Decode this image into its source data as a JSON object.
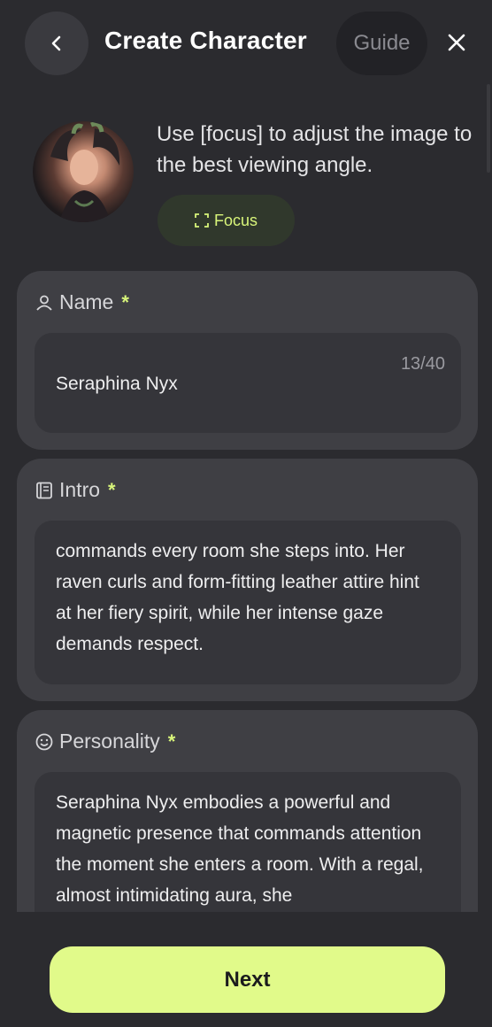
{
  "header": {
    "title": "Create Character",
    "guide_label": "Guide"
  },
  "image": {
    "hint": "Use [focus] to adjust the image to the best viewing angle.",
    "focus_label": "Focus"
  },
  "name_field": {
    "label": "Name",
    "required_mark": "*",
    "value": "Seraphina Nyx",
    "counter": "13/40"
  },
  "intro_field": {
    "label": "Intro",
    "required_mark": "*",
    "value": "commands every room she steps into. Her raven curls and form-fitting leather attire hint at her fiery spirit, while her intense gaze demands respect."
  },
  "personality_field": {
    "label": "Personality",
    "required_mark": "*",
    "value": "Seraphina Nyx embodies a powerful and magnetic presence that commands attention the moment she enters a room. With a regal, almost intimidating aura, she"
  },
  "footer": {
    "next_label": "Next"
  },
  "colors": {
    "background": "#2b2b2f",
    "accent": "#e1fa8a",
    "card": "#3f3f44"
  }
}
